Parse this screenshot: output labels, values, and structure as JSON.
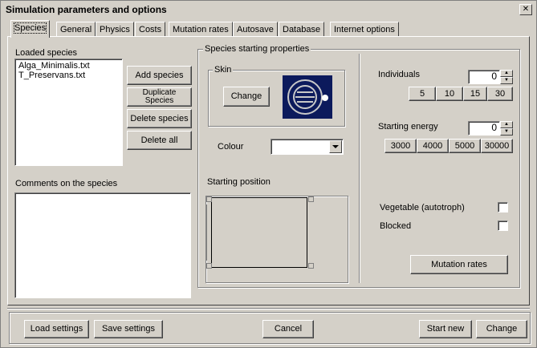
{
  "window": {
    "title": "Simulation parameters and options",
    "close_glyph": "✕"
  },
  "tabs": [
    {
      "label": "Species",
      "active": true
    },
    {
      "label": "General"
    },
    {
      "label": "Physics"
    },
    {
      "label": "Costs"
    },
    {
      "label": "Mutation rates"
    },
    {
      "label": "Autosave"
    },
    {
      "label": "Database"
    },
    {
      "label": "Internet options"
    }
  ],
  "species_panel": {
    "loaded_label": "Loaded species",
    "loaded_items": [
      "Alga_Minimalis.txt",
      "T_Preservans.txt"
    ],
    "add_label": "Add species",
    "duplicate_label": "Duplicate Species",
    "delete_label": "Delete species",
    "delete_all_label": "Delete all",
    "comments_label": "Comments on the species",
    "comments_value": ""
  },
  "properties": {
    "group_label": "Species starting properties",
    "skin_label": "Skin",
    "change_label": "Change",
    "colour_label": "Colour",
    "colour_value": "",
    "starting_position_label": "Starting position"
  },
  "right": {
    "individuals_label": "Individuals",
    "individuals_value": "0",
    "individuals_presets": [
      "5",
      "10",
      "15",
      "30"
    ],
    "energy_label": "Starting energy",
    "energy_value": "0",
    "energy_presets": [
      "3000",
      "4000",
      "5000",
      "30000"
    ],
    "vegetable_label": "Vegetable (autotroph)",
    "blocked_label": "Blocked",
    "mutation_rates_label": "Mutation rates"
  },
  "footer": {
    "load_label": "Load settings",
    "save_label": "Save settings",
    "cancel_label": "Cancel",
    "start_label": "Start new",
    "change_label": "Change"
  },
  "colors": {
    "skin_bg": "#0c1a5c",
    "skin_ring": "#c8c8c8",
    "dialog_bg": "#d4d0c8"
  }
}
